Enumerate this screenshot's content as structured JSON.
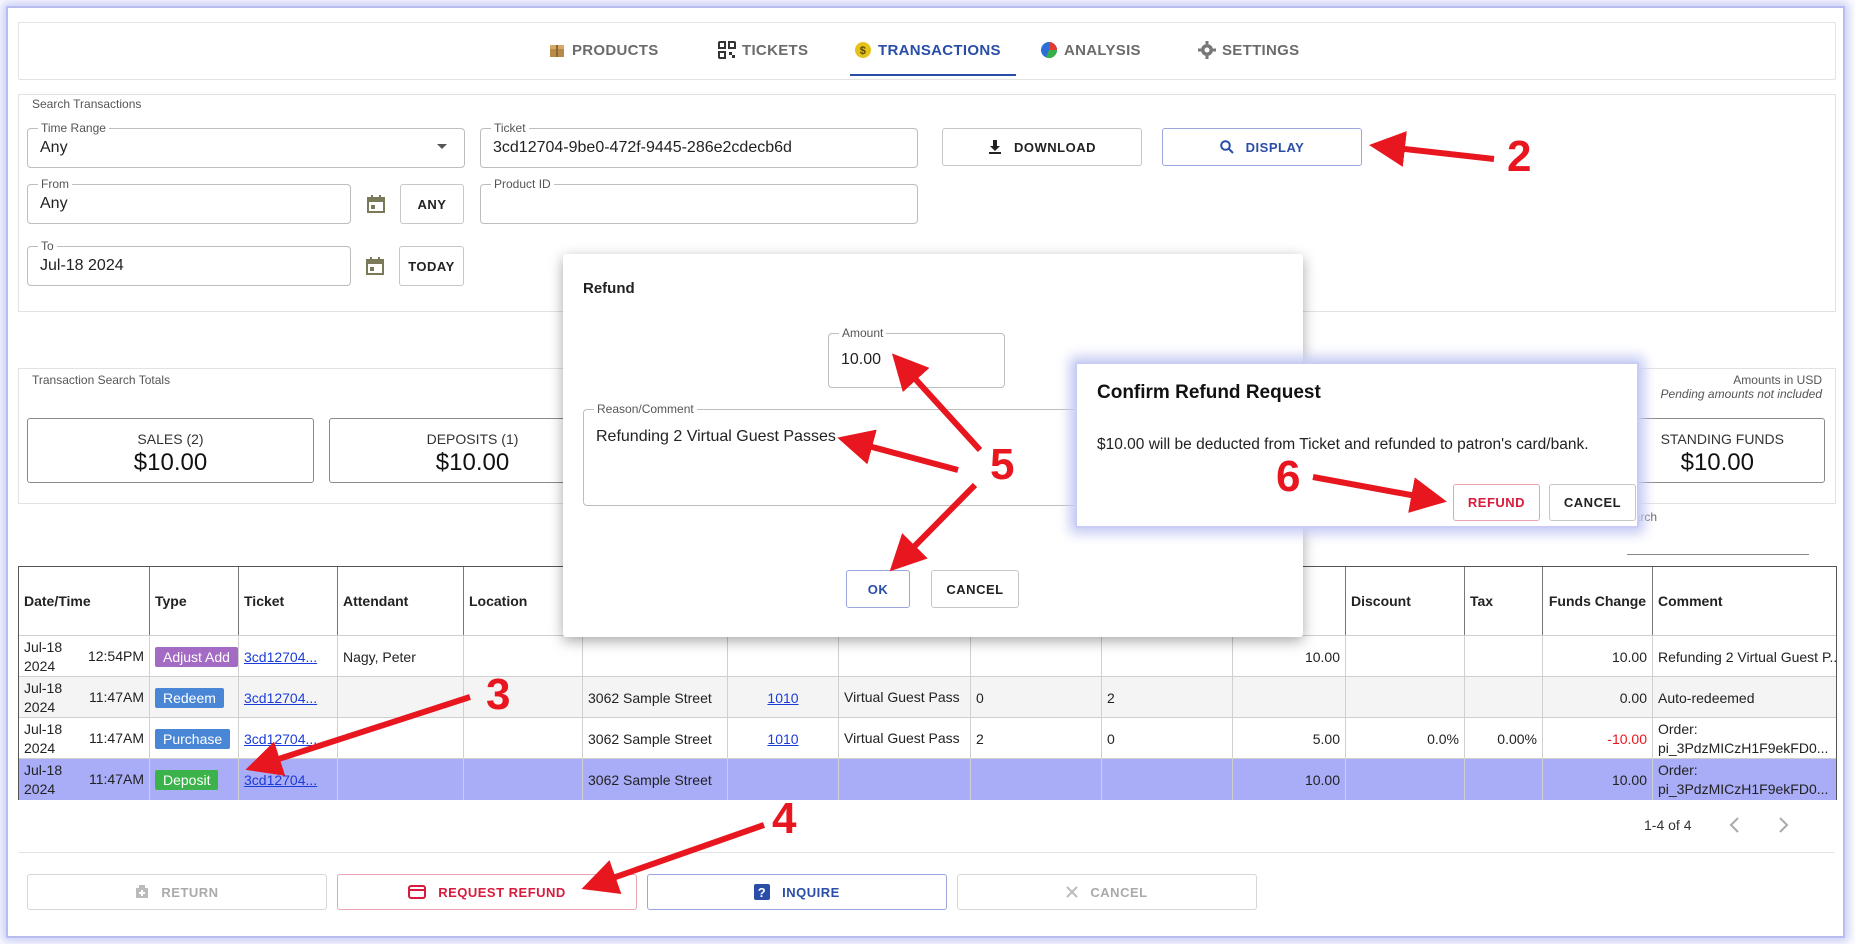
{
  "nav": {
    "tabs": [
      {
        "label": "PRODUCTS",
        "icon": "box-icon"
      },
      {
        "label": "TICKETS",
        "icon": "qr-code-icon"
      },
      {
        "label": "TRANSACTIONS",
        "icon": "dollar-coin-icon"
      },
      {
        "label": "ANALYSIS",
        "icon": "pie-chart-icon"
      },
      {
        "label": "SETTINGS",
        "icon": "gear-icon"
      }
    ],
    "active": "TRANSACTIONS"
  },
  "search": {
    "title": "Search Transactions",
    "time_range_label": "Time Range",
    "time_range_value": "Any",
    "ticket_label": "Ticket",
    "ticket_value": "3cd12704-9be0-472f-9445-286e2cdecb6d",
    "from_label": "From",
    "from_value": "Any",
    "any_btn": "ANY",
    "product_id_label": "Product ID",
    "product_id_value": "",
    "to_label": "To",
    "to_value": "Jul-18 2024",
    "today_btn": "TODAY",
    "download_btn": "DOWNLOAD",
    "display_btn": "DISPLAY"
  },
  "totals": {
    "title": "Transaction Search Totals",
    "currency_note": "Amounts in USD",
    "pending_note": "Pending amounts not included",
    "cards": [
      {
        "label": "SALES (2)",
        "value": "$10.00"
      },
      {
        "label": "DEPOSITS (1)",
        "value": "$10.00"
      },
      {
        "label": "STANDING FUNDS",
        "value": "$10.00"
      }
    ],
    "search_label": "earch"
  },
  "table": {
    "headers": [
      "Date/Time",
      "Type",
      "Ticket",
      "Attendant",
      "Location",
      "",
      "",
      "",
      "",
      "",
      "Discount",
      "Tax",
      "Funds Change",
      "Comment"
    ],
    "rows": [
      {
        "date": "Jul-18 2024",
        "time": "12:54PM",
        "type": "Adjust Add",
        "ticket": "3cd12704...",
        "attendant": "Nagy, Peter",
        "location": "",
        "pid": "",
        "product": "",
        "qty": "",
        "remaining": "",
        "amount": "10.00",
        "discount": "",
        "tax": "",
        "funds": "10.00",
        "comment": "Refunding 2 Virtual Guest P..."
      },
      {
        "date": "Jul-18 2024",
        "time": "11:47AM",
        "type": "Redeem",
        "ticket": "3cd12704...",
        "attendant": "",
        "location": "3062 Sample Street",
        "pid": "1010",
        "product": "Virtual Guest Pass",
        "qty": "0",
        "remaining": "2",
        "amount": "",
        "discount": "",
        "tax": "",
        "funds": "0.00",
        "comment": "Auto-redeemed"
      },
      {
        "date": "Jul-18 2024",
        "time": "11:47AM",
        "type": "Purchase",
        "ticket": "3cd12704...",
        "attendant": "",
        "location": "3062 Sample Street",
        "pid": "1010",
        "product": "Virtual Guest Pass",
        "qty": "2",
        "remaining": "0",
        "amount": "5.00",
        "discount": "0.0%",
        "tax": "0.00%",
        "funds": "-10.00",
        "comment": "Order: pi_3PdzMICzH1F9ekFD0..."
      },
      {
        "date": "Jul-18 2024",
        "time": "11:47AM",
        "type": "Deposit",
        "ticket": "3cd12704...",
        "attendant": "",
        "location": "3062 Sample Street",
        "pid": "",
        "product": "",
        "qty": "",
        "remaining": "",
        "amount": "10.00",
        "discount": "",
        "tax": "",
        "funds": "10.00",
        "comment": "Order: pi_3PdzMICzH1F9ekFD0..."
      }
    ],
    "pagination": "1-4 of 4"
  },
  "actions": {
    "return": "RETURN",
    "request_refund": "REQUEST REFUND",
    "inquire": "INQUIRE",
    "cancel": "CANCEL"
  },
  "refund_dialog": {
    "title": "Refund",
    "amount_label": "Amount",
    "amount_value": "10.00",
    "reason_label": "Reason/Comment",
    "reason_value": "Refunding 2 Virtual Guest Passes",
    "ok_btn": "OK",
    "cancel_btn": "CANCEL"
  },
  "confirm_dialog": {
    "title": "Confirm Refund Request",
    "message": "$10.00 will be deducted from Ticket and refunded to patron's card/bank.",
    "refund_btn": "REFUND",
    "cancel_btn": "CANCEL"
  },
  "annotations": [
    "2",
    "3",
    "4",
    "5",
    "6"
  ],
  "colors": {
    "accent": "#2a4ea8",
    "adjust_add": "#a46bc4",
    "redeem": "#4a86d6",
    "purchase": "#4a86d6",
    "deposit": "#3cb34a",
    "selected_row": "#a9acf7",
    "annotation_red": "#e8161e",
    "negative": "#e8161e"
  }
}
